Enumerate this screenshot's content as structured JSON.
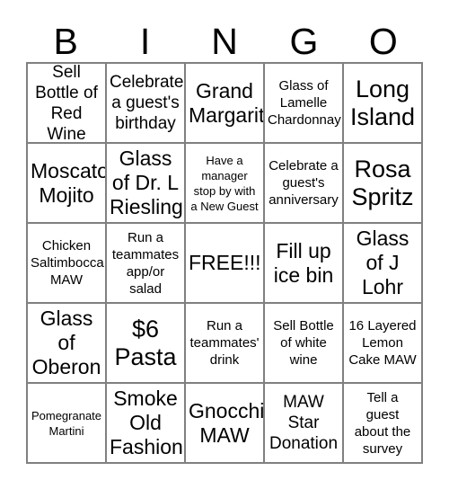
{
  "header": {
    "letters": [
      "B",
      "I",
      "N",
      "G",
      "O"
    ]
  },
  "grid": {
    "rows": 5,
    "columns": 5,
    "border_color": "#808080",
    "background_color": "#ffffff",
    "text_color": "#000000",
    "cells": [
      {
        "text": "Sell\nBottle of\nRed Wine",
        "size": "md"
      },
      {
        "text": "Celebrate\na guest's\nbirthday",
        "size": "md"
      },
      {
        "text": "Grand\nMargarita",
        "size": "lg"
      },
      {
        "text": "Glass of\nLamelle\nChardonnay",
        "size": "sm"
      },
      {
        "text": "Long\nIsland",
        "size": "xl"
      },
      {
        "text": "Moscato\nMojito",
        "size": "lg"
      },
      {
        "text": "Glass\nof Dr. L\nRiesling",
        "size": "lg"
      },
      {
        "text": "Have a\nmanager\nstop by with\na New Guest",
        "size": "xs"
      },
      {
        "text": "Celebrate a\nguest's\nanniversary",
        "size": "sm"
      },
      {
        "text": "Rosa\nSpritz",
        "size": "xl"
      },
      {
        "text": "Chicken\nSaltimbocca\nMAW",
        "size": "sm"
      },
      {
        "text": "Run a\nteammates\napp/or\nsalad",
        "size": "sm"
      },
      {
        "text": "FREE!!!",
        "size": "lg"
      },
      {
        "text": "Fill up\nice bin",
        "size": "lg"
      },
      {
        "text": "Glass\nof J\nLohr",
        "size": "lg"
      },
      {
        "text": "Glass\nof\nOberon",
        "size": "lg"
      },
      {
        "text": "$6\nPasta",
        "size": "xl"
      },
      {
        "text": "Run a\nteammates'\ndrink",
        "size": "sm"
      },
      {
        "text": "Sell Bottle\nof white\nwine",
        "size": "sm"
      },
      {
        "text": "16 Layered\nLemon\nCake MAW",
        "size": "sm"
      },
      {
        "text": "Pomegranate\nMartini",
        "size": "xs"
      },
      {
        "text": "Smoke\nOld\nFashion",
        "size": "lg"
      },
      {
        "text": "Gnocchi\nMAW",
        "size": "lg"
      },
      {
        "text": "MAW\nStar\nDonation",
        "size": "md"
      },
      {
        "text": "Tell a\nguest\nabout the\nsurvey",
        "size": "sm"
      }
    ]
  }
}
